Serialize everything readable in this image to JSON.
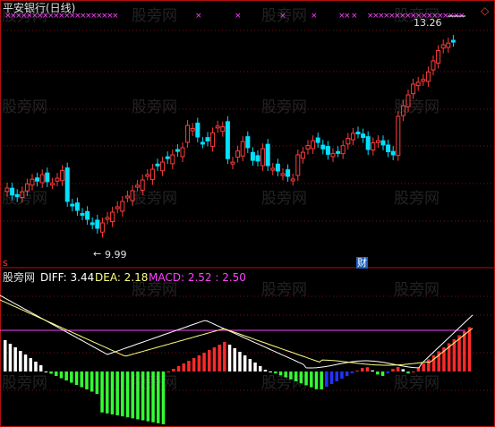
{
  "header": {
    "title": "平安银行(日线)",
    "title_color": "#e0e0e0"
  },
  "price_panel": {
    "high_label": "13.26",
    "low_label": "9.99",
    "arrow_left": "←",
    "finance_marker": "财",
    "s_marker": "s",
    "cross_marker": "×",
    "diamond_marker": "◇",
    "up_color": "#ff3c3c",
    "down_color": "#00e0ff",
    "ma_color": "#ffffff",
    "cross_color": "#ff40ff"
  },
  "indicator_panel": {
    "site": "股旁网",
    "diff_label": "DIFF: 3.44",
    "dea_label": "DEA: 2.18",
    "macd_label": "MACD: 2.52 : 2.50",
    "diff_color": "#ffffff",
    "dea_color": "#ffff80",
    "macd_color": "#ff40ff",
    "bar_colors": [
      "#ffffff",
      "#ff2a2a",
      "#33ff33",
      "#2233ff"
    ]
  },
  "watermark": {
    "text": "股旁网"
  },
  "icons": {
    "diamond": "diamond-icon",
    "arrow": "arrow-left-icon"
  }
}
